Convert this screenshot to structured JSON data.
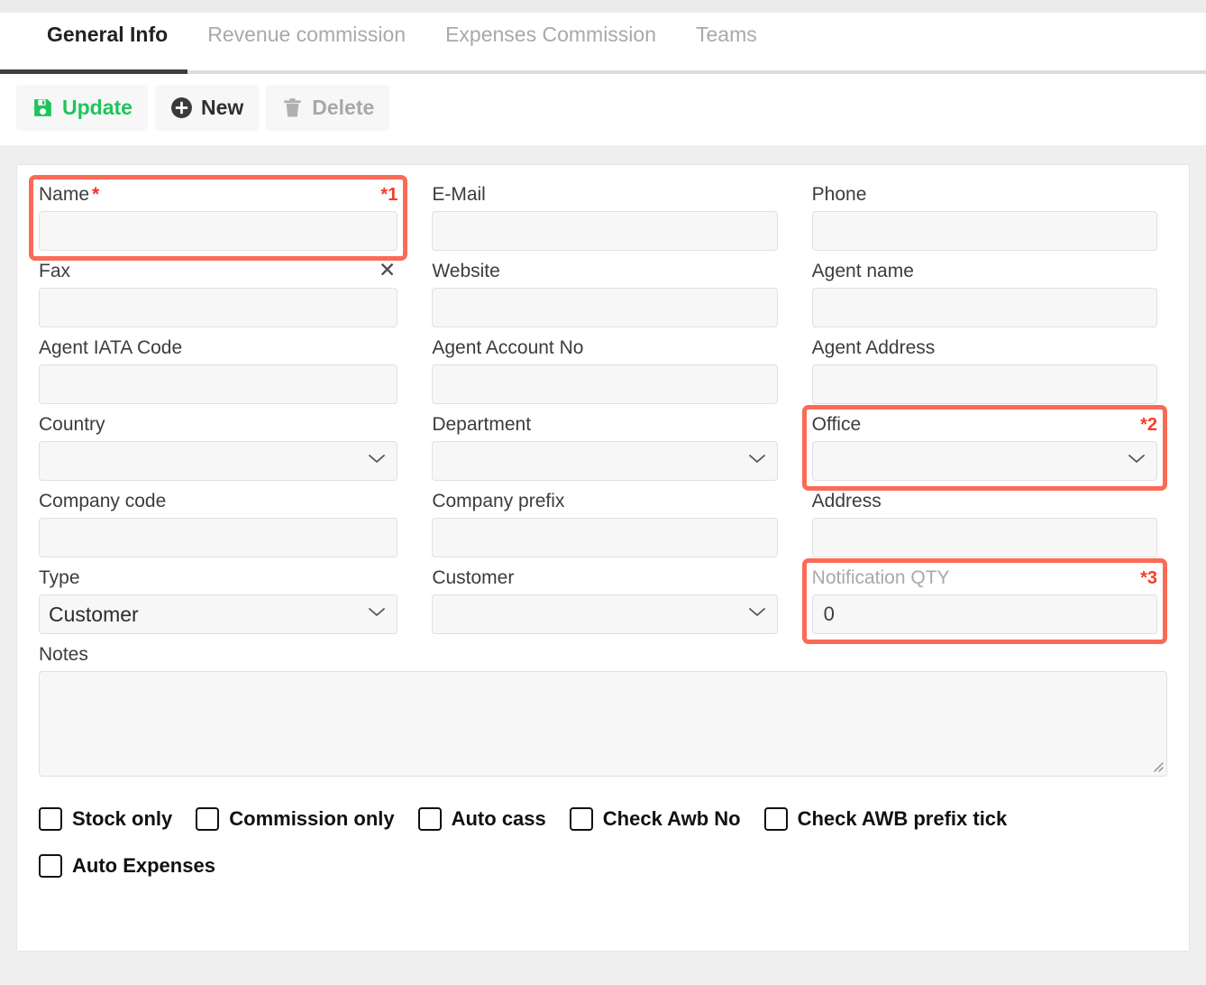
{
  "tabs": [
    {
      "label": "General Info",
      "active": true
    },
    {
      "label": "Revenue commission",
      "active": false
    },
    {
      "label": "Expenses Commission",
      "active": false
    },
    {
      "label": "Teams",
      "active": false
    }
  ],
  "toolbar": {
    "update_label": "Update",
    "new_label": "New",
    "delete_label": "Delete"
  },
  "form": {
    "rows": [
      [
        {
          "label": "Name",
          "required": true,
          "annotation": "*1",
          "highlight": true,
          "control": "text",
          "value": "",
          "placeholder": ""
        },
        {
          "label": "E-Mail",
          "control": "text",
          "value": "",
          "placeholder": ""
        },
        {
          "label": "Phone",
          "control": "text",
          "value": "",
          "placeholder": ""
        }
      ],
      [
        {
          "label": "Fax",
          "clearable": true,
          "control": "text",
          "value": "",
          "placeholder": ""
        },
        {
          "label": "Website",
          "control": "text",
          "value": "",
          "placeholder": ""
        },
        {
          "label": "Agent name",
          "control": "text",
          "value": "",
          "placeholder": ""
        }
      ],
      [
        {
          "label": "Agent IATA Code",
          "control": "text",
          "value": "",
          "placeholder": ""
        },
        {
          "label": "Agent Account No",
          "control": "text",
          "value": "",
          "placeholder": ""
        },
        {
          "label": "Agent Address",
          "control": "text",
          "value": "",
          "placeholder": ""
        }
      ],
      [
        {
          "label": "Country",
          "control": "select",
          "value": ""
        },
        {
          "label": "Department",
          "control": "select",
          "value": ""
        },
        {
          "label": "Office",
          "annotation": "*2",
          "highlight": true,
          "control": "select",
          "value": ""
        }
      ],
      [
        {
          "label": "Company code",
          "control": "text",
          "value": "",
          "placeholder": ""
        },
        {
          "label": "Company prefix",
          "control": "text",
          "value": "",
          "placeholder": ""
        },
        {
          "label": "Address",
          "control": "text",
          "value": "",
          "placeholder": ""
        }
      ],
      [
        {
          "label": "Type",
          "control": "select",
          "value": "Customer"
        },
        {
          "label": "Customer",
          "control": "select",
          "value": ""
        },
        {
          "label": "Notification QTY",
          "annotation": "*3",
          "highlight": true,
          "muted_label": true,
          "control": "text",
          "value": "0",
          "placeholder": ""
        }
      ]
    ],
    "notes": {
      "label": "Notes",
      "value": "",
      "placeholder": ""
    },
    "checkboxes_row1": [
      {
        "label": "Stock only",
        "checked": false
      },
      {
        "label": "Commission only",
        "checked": false
      },
      {
        "label": "Auto cass",
        "checked": false
      },
      {
        "label": "Check Awb No",
        "checked": false
      },
      {
        "label": "Check AWB prefix tick",
        "checked": false
      }
    ],
    "checkboxes_row2": [
      {
        "label": "Auto Expenses",
        "checked": false
      }
    ]
  },
  "colors": {
    "accent_green": "#20c45c",
    "highlight_red": "#fb6a56",
    "annotation_red": "#fa3b2a",
    "required_red": "#ff2b2b",
    "tab_active": "#222222",
    "tab_inactive": "#a9a9a9"
  }
}
